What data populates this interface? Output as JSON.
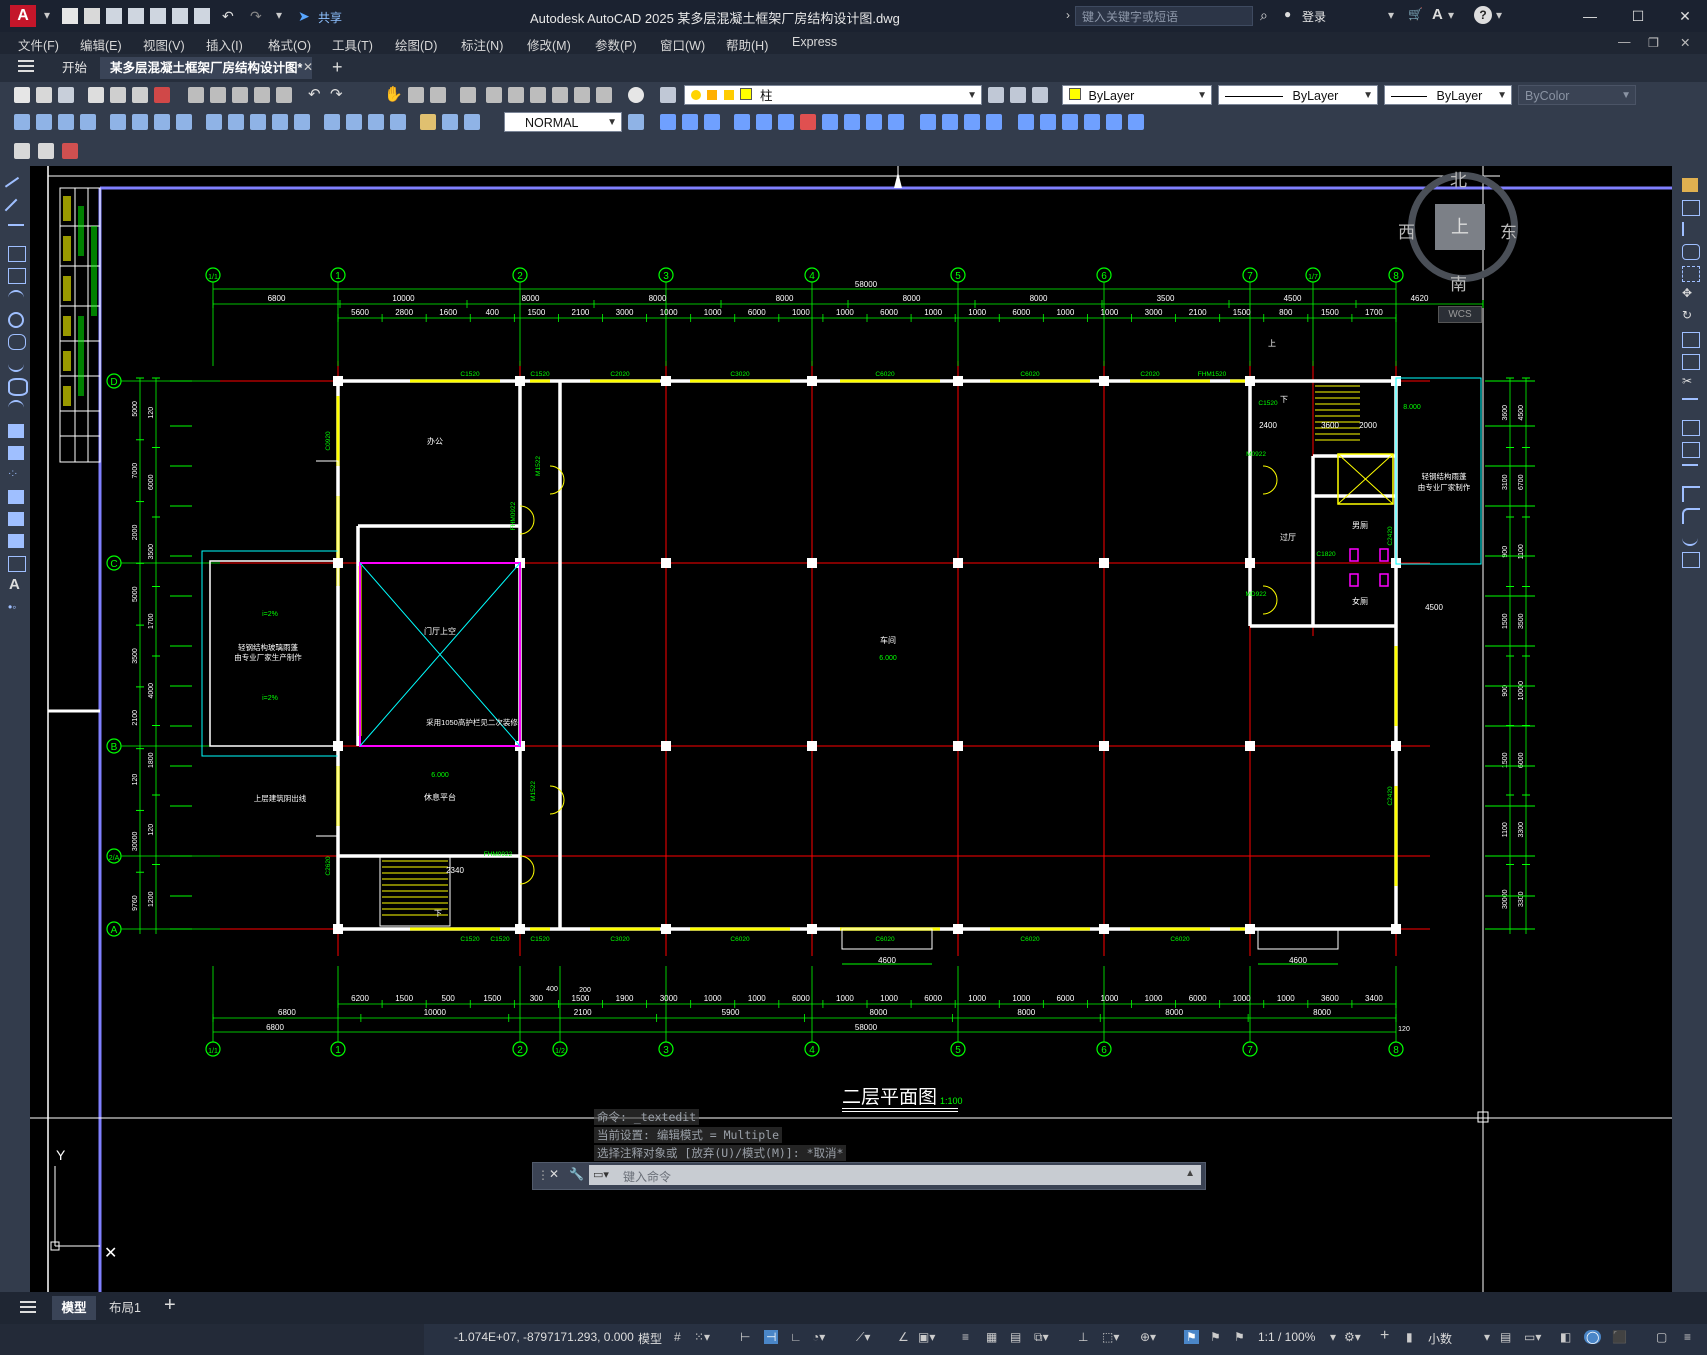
{
  "app": {
    "logo": "A",
    "title": "Autodesk AutoCAD 2025    某多层混凝土框架厂房结构设计图.dwg",
    "share": "共享",
    "search_placeholder": "键入关键字或短语",
    "login": "登录"
  },
  "menus": [
    "文件(F)",
    "编辑(E)",
    "视图(V)",
    "插入(I)",
    "格式(O)",
    "工具(T)",
    "绘图(D)",
    "标注(N)",
    "修改(M)",
    "参数(P)",
    "窗口(W)",
    "帮助(H)",
    "Express"
  ],
  "tabs": [
    {
      "label": "开始",
      "active": false
    },
    {
      "label": "某多层混凝土框架厂房结构设计图*",
      "active": true
    }
  ],
  "toolbar": {
    "layer_name": "柱",
    "color": "ByLayer",
    "linetype": "ByLayer",
    "lineweight": "ByLayer",
    "plotstyle": "ByColor",
    "dimstyle": "NORMAL"
  },
  "viewcube": {
    "north": "北",
    "south": "南",
    "east": "东",
    "west": "西",
    "top": "上",
    "wcs": "WCS"
  },
  "drawing": {
    "title": "二层平面图",
    "scale": "1:100",
    "axes_top": [
      "1/1",
      "1",
      "2",
      "3",
      "4",
      "5",
      "6",
      "7",
      "1/7",
      "8"
    ],
    "axes_bottom": [
      "1/1",
      "1",
      "2",
      "1/2",
      "3",
      "4",
      "5",
      "6",
      "7",
      "8"
    ],
    "axes_left": [
      "D",
      "C",
      "B",
      "2/A",
      "A"
    ],
    "dim_total": "58000",
    "dim_total_bottom": "58000",
    "top_dims_row2": [
      "6800",
      "10000",
      "8000",
      "8000",
      "8000",
      "8000",
      "8000",
      "3500",
      "4500",
      "4620"
    ],
    "top_dims_row3": [
      "5600",
      "2800",
      "1600",
      "400",
      "1500",
      "2100",
      "3000",
      "1000",
      "1000",
      "6000",
      "1000",
      "1000",
      "6000",
      "1000",
      "1000",
      "6000",
      "1000",
      "1000",
      "3000",
      "2100",
      "1500",
      "800",
      "1500",
      "1700"
    ],
    "bottom_dims_row1": [
      "6200",
      "1500",
      "500",
      "1500",
      "300",
      "1500",
      "1900",
      "3000",
      "1000",
      "1000",
      "6000",
      "1000",
      "1000",
      "6000",
      "1000",
      "1000",
      "6000",
      "1000",
      "1000",
      "6000",
      "1000",
      "1000",
      "3600",
      "3400"
    ],
    "bottom_dims_row2": [
      "6800",
      "10000",
      "2100",
      "5900",
      "8000",
      "8000",
      "8000",
      "8000"
    ],
    "bottom_dims_row3": [
      "6800",
      "58000"
    ],
    "bottom_small": [
      "400",
      "200",
      "120"
    ],
    "left_dims": [
      "5000",
      "7000",
      "2000",
      "5000",
      "3500",
      "2100",
      "120",
      "30000",
      "9760",
      "120",
      "6000",
      "3500",
      "1700",
      "4000",
      "1800",
      "120",
      "1200"
    ],
    "right_dims": [
      "3600",
      "3100",
      "900",
      "1500",
      "900",
      "1500",
      "1100",
      "30000",
      "4500",
      "6700",
      "1100",
      "3500",
      "10000",
      "6000",
      "3300",
      "3300"
    ],
    "room_labels": [
      "办公",
      "门厅上空",
      "休息平台",
      "车间",
      "过厅",
      "男厕",
      "女厕"
    ],
    "notes": [
      "轻钢结构玻璃雨蓬",
      "由专业厂家生产制作",
      "轻钢结构雨蓬",
      "由专业厂家制作",
      "上层建筑阴出线",
      "采用1050高护栏见二次装修"
    ],
    "labels_misc": [
      "i=2%",
      "i=2%",
      "6.000",
      "6.000",
      "8.000",
      "下",
      "上",
      "2340",
      "2400",
      "3600",
      "2000",
      "4600",
      "4600",
      "4500",
      "C1520",
      "C2020",
      "C2420",
      "C3020",
      "C6020",
      "FHM1520",
      "M1522",
      "FHM0922",
      "M0922",
      "MD922",
      "C1820",
      "C0920",
      "C2620"
    ]
  },
  "command": {
    "history": [
      "命令:  _textedit",
      "当前设置: 编辑模式 = Multiple",
      "选择注释对象或 [放弃(U)/模式(M)]: *取消*"
    ],
    "placeholder": "键入命令"
  },
  "layout_tabs": [
    {
      "label": "模型",
      "active": true
    },
    {
      "label": "布局1",
      "active": false
    }
  ],
  "status": {
    "coords": "-1.074E+07, -8797171.293, 0.000",
    "model": "模型",
    "annoscale": "1:1 / 100%",
    "units": "小数"
  },
  "colors": {
    "accent": "#c4162a",
    "green": "#00ff00",
    "red": "#ff0000",
    "yellow": "#ffff00",
    "cyan": "#00ffff",
    "magenta": "#ff00ff",
    "white": "#ffffff",
    "violet": "#8080ff"
  }
}
